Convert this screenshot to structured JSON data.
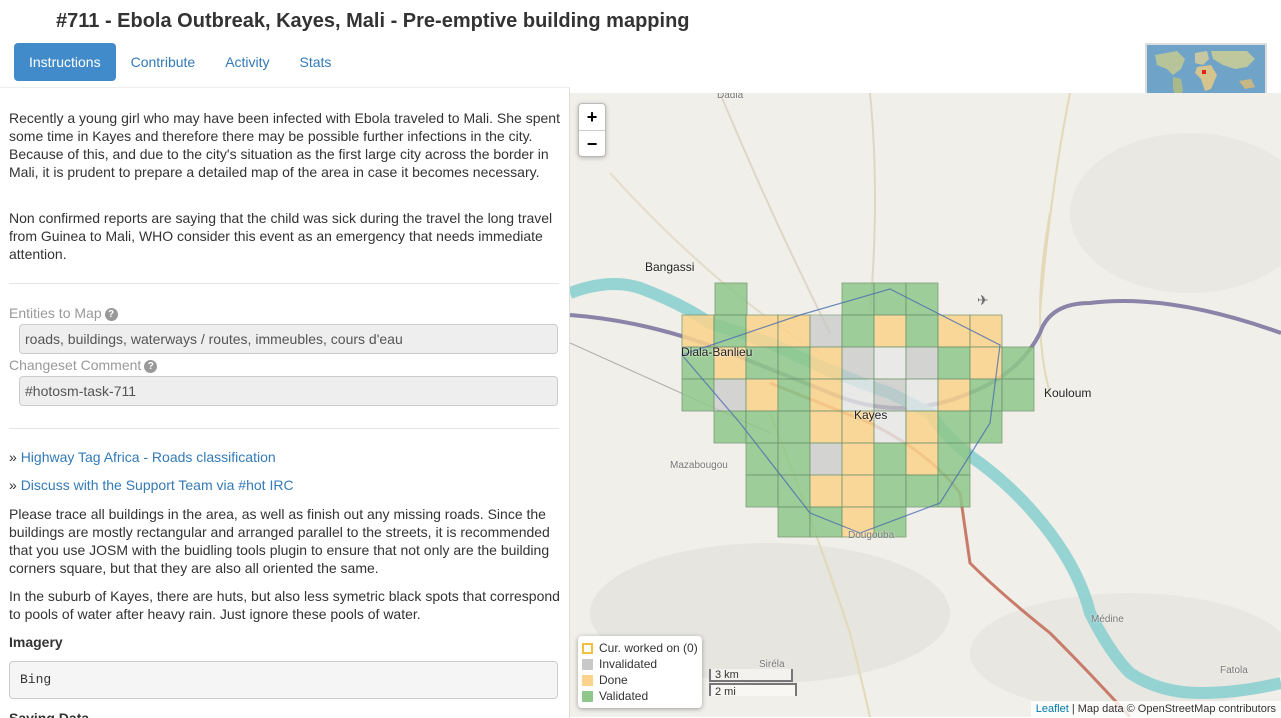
{
  "page": {
    "title": "#711 - Ebola Outbreak, Kayes, Mali - Pre-emptive building mapping"
  },
  "tabs": [
    {
      "label": "Instructions",
      "active": true
    },
    {
      "label": "Contribute",
      "active": false
    },
    {
      "label": "Activity",
      "active": false
    },
    {
      "label": "Stats",
      "active": false
    }
  ],
  "description": {
    "paragraph1": "Recently a young girl who may have been infected with Ebola traveled to Mali. She spent some time in Kayes and therefore there may be possible further infections in the city. Because of this, and due to the city's situation as the first large city across the border in Mali, it is prudent to prepare a detailed map of the area in case it becomes necessary.",
    "paragraph2": "Non confirmed reports are saying that the child was sick during the travel the long travel from Guinea to Mali, WHO consider this event as an emergency that needs immediate attention."
  },
  "entities": {
    "label": "Entities to Map",
    "help_icon": "question-circle-icon",
    "value": "roads, buildings, waterways / routes, immeubles, cours d'eau"
  },
  "changeset": {
    "label": "Changeset Comment",
    "help_icon": "question-circle-icon",
    "value": "#hotosm-task-711"
  },
  "links": [
    {
      "prefix": "»",
      "text": "Highway Tag Africa - Roads classification"
    },
    {
      "prefix": "»",
      "text": "Discuss with the Support Team via #hot IRC"
    }
  ],
  "instructions": {
    "paragraph1": "Please trace all buildings in the area, as well as finish out any missing roads. Since the buildings are mostly rectangular and arranged parallel to the streets, it is recommended that you use JOSM with the buidling tools plugin to ensure that not only are the building corners square, but that they are also all oriented the same.",
    "paragraph2": "In the suburb of Kayes, there are huts, but also less symetric black spots that correspond to pools of water after heavy rain. Just ignore these pools of water."
  },
  "imagery": {
    "heading": "Imagery",
    "value": "Bing"
  },
  "next_heading": "Saving Data",
  "map": {
    "zoom_in": "+",
    "zoom_out": "−",
    "places": {
      "dadia": "Dadia",
      "bangassi": "Bangassi",
      "diala": "Diala-Banlieu",
      "kayes": "Kayes",
      "kouloum": "Kouloum",
      "mazabougou": "Mazabougou",
      "dougouba": "Dougouba",
      "siréla": "Siréla",
      "medine": "Médine",
      "fatola": "Fatola"
    },
    "legend": [
      {
        "label": "Cur. worked on (0)",
        "color": "#ffffff",
        "border": "#f0c040"
      },
      {
        "label": "Invalidated",
        "color": "#c8c8c8",
        "border": "#c8c8c8"
      },
      {
        "label": "Done",
        "color": "#fbd38c",
        "border": "#fbd38c"
      },
      {
        "label": "Validated",
        "color": "#8fc88a",
        "border": "#8fc88a"
      }
    ],
    "scale": {
      "metric": "3 km",
      "imperial": "2 mi"
    },
    "attribution": {
      "leaflet": "Leaflet",
      "text": "| Map data © OpenStreetMap contributors"
    }
  },
  "colors": {
    "tab_active": "#428bca",
    "link": "#337ab7",
    "done": "#fbd38c",
    "validated": "#8fc88a",
    "invalidated": "#c8c8c8",
    "river": "#8ccfd0"
  }
}
